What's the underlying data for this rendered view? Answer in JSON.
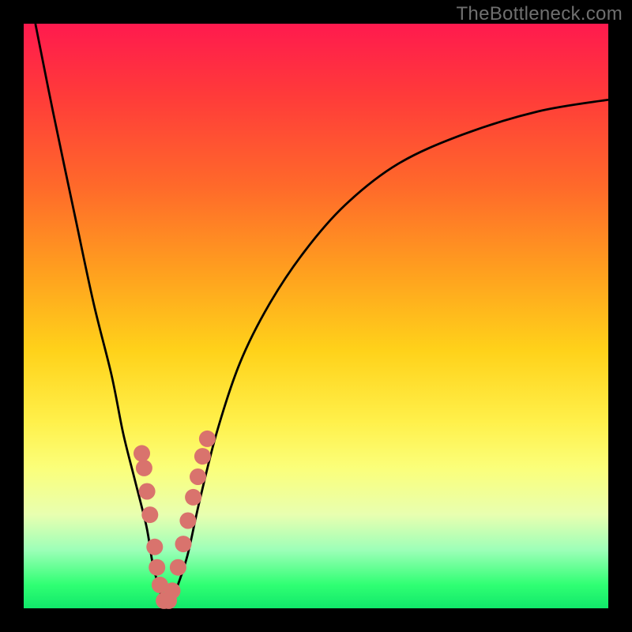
{
  "watermark": "TheBottleneck.com",
  "chart_data": {
    "type": "line",
    "title": "",
    "xlabel": "",
    "ylabel": "",
    "xlim": [
      0,
      100
    ],
    "ylim": [
      0,
      100
    ],
    "series": [
      {
        "name": "bottleneck-curve",
        "curve_type": "v-shape",
        "x": [
          2,
          5,
          9,
          12,
          15,
          17,
          19,
          21,
          22,
          23,
          24,
          25,
          26,
          28,
          30,
          33,
          37,
          42,
          48,
          55,
          64,
          75,
          88,
          100
        ],
        "y": [
          100,
          85,
          66,
          52,
          40,
          30,
          22,
          14,
          8,
          4,
          1,
          1,
          3,
          9,
          18,
          30,
          42,
          52,
          61,
          69,
          76,
          81,
          85,
          87
        ]
      }
    ],
    "x_at_min": 24,
    "markers": [
      {
        "x": 20.2,
        "y": 26.5
      },
      {
        "x": 20.6,
        "y": 24.0
      },
      {
        "x": 21.1,
        "y": 20.0
      },
      {
        "x": 21.6,
        "y": 16.0
      },
      {
        "x": 22.4,
        "y": 10.5
      },
      {
        "x": 22.8,
        "y": 7.0
      },
      {
        "x": 23.3,
        "y": 4.0
      },
      {
        "x": 24.0,
        "y": 1.3
      },
      {
        "x": 24.8,
        "y": 1.3
      },
      {
        "x": 25.4,
        "y": 3.0
      },
      {
        "x": 26.4,
        "y": 7.0
      },
      {
        "x": 27.3,
        "y": 11.0
      },
      {
        "x": 28.1,
        "y": 15.0
      },
      {
        "x": 29.0,
        "y": 19.0
      },
      {
        "x": 29.8,
        "y": 22.5
      },
      {
        "x": 30.6,
        "y": 26.0
      },
      {
        "x": 31.4,
        "y": 29.0
      }
    ],
    "marker_color": "#d9736d",
    "curve_color": "#000000"
  }
}
